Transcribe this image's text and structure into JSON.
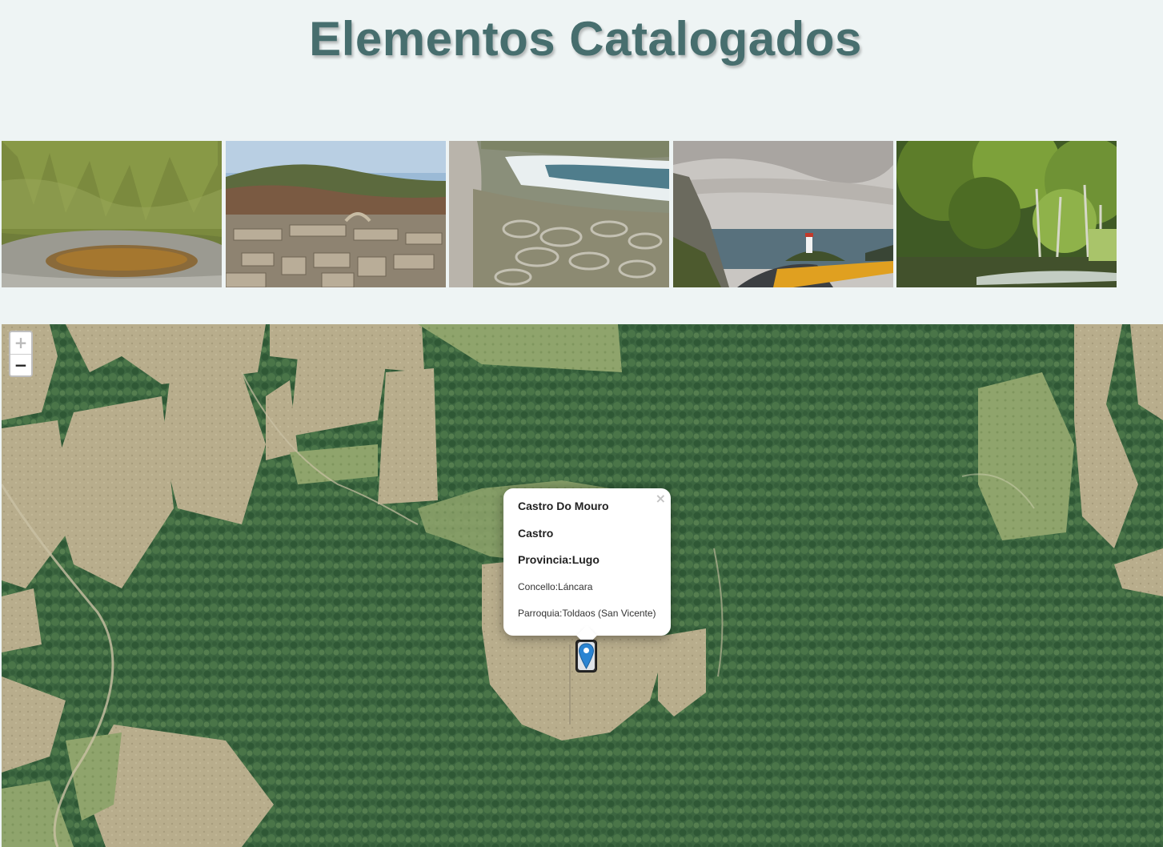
{
  "page": {
    "title": "Elementos Catalogados"
  },
  "gallery": {
    "photos": [
      {
        "name": "rock-pool-photo"
      },
      {
        "name": "ruins-photo"
      },
      {
        "name": "coastal-castro-photo"
      },
      {
        "name": "lighthouse-photo"
      },
      {
        "name": "river-forest-photo"
      }
    ]
  },
  "map": {
    "zoom_in": "+",
    "zoom_out": "−",
    "popup": {
      "close": "×",
      "name": "Castro Do Mouro",
      "type": "Castro",
      "provincia": "Provincia:Lugo",
      "concello": "Concello:Láncara",
      "parroquia": "Parroquia:Toldaos (San Vicente)"
    },
    "marker_icon": "map-pin-icon"
  }
}
